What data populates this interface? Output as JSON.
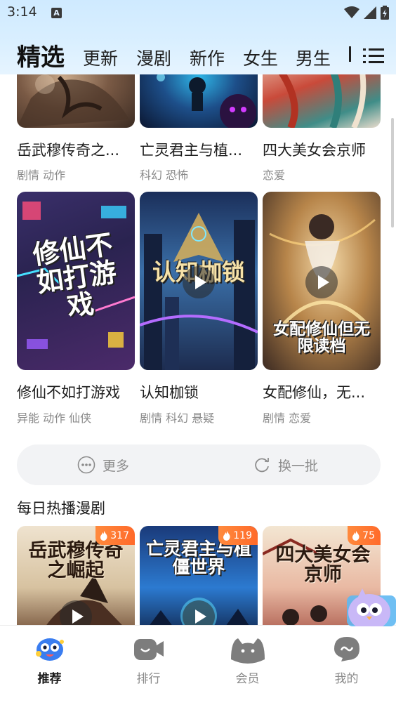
{
  "status_bar": {
    "time": "3:14",
    "notification_letter": "A"
  },
  "tabs": [
    {
      "label": "精选",
      "active": true
    },
    {
      "label": "更新"
    },
    {
      "label": "漫剧"
    },
    {
      "label": "新作"
    },
    {
      "label": "女生"
    },
    {
      "label": "男生"
    }
  ],
  "top_row": [
    {
      "title": "岳武穆传奇之...",
      "tags": "剧情 动作"
    },
    {
      "title": "亡灵君主与植...",
      "tags": "科幻 恐怖"
    },
    {
      "title": "四大美女会京师",
      "tags": "恋爱"
    }
  ],
  "second_row": [
    {
      "title": "修仙不如打游戏",
      "tags": "异能 动作 仙侠",
      "cover_text": "修仙不如打游戏"
    },
    {
      "title": "认知枷锁",
      "tags": "剧情 科幻 悬疑",
      "cover_text": "认知枷锁"
    },
    {
      "title": "女配修仙，无...",
      "tags": "剧情 恋爱",
      "cover_text": "女配修仙但无限读档"
    }
  ],
  "actions": {
    "more": "更多",
    "refresh": "换一批"
  },
  "section": {
    "title": "每日热播漫剧"
  },
  "hot_row": [
    {
      "heat": "317",
      "cover_text": "岳武穆传奇之崛起"
    },
    {
      "heat": "119",
      "cover_text": "亡灵君主与植僵世界"
    },
    {
      "heat": "75",
      "cover_text": "四大美女会京师"
    }
  ],
  "bottom_nav": [
    {
      "label": "推荐",
      "icon": "recommend-icon",
      "active": true
    },
    {
      "label": "排行",
      "icon": "ranking-icon"
    },
    {
      "label": "会员",
      "icon": "member-icon"
    },
    {
      "label": "我的",
      "icon": "profile-icon"
    }
  ],
  "colors": {
    "accent_orange": "#ff6a2a",
    "header_blue": "#d9efff"
  }
}
